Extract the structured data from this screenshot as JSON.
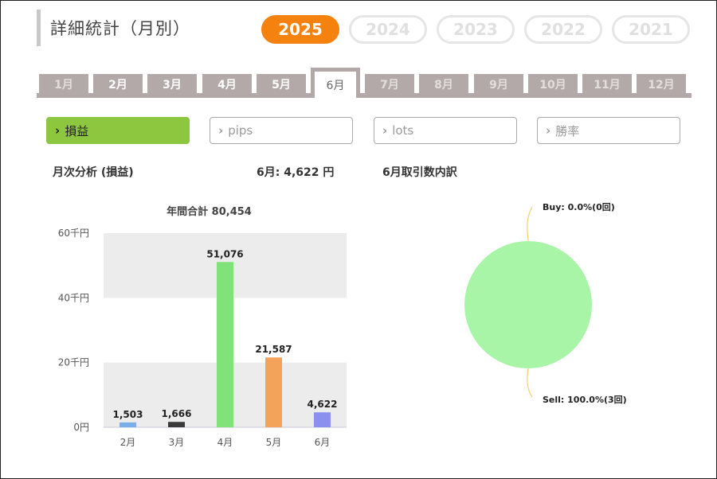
{
  "header": {
    "title": "詳細統計（月別）"
  },
  "years": [
    {
      "label": "2025",
      "active": true
    },
    {
      "label": "2024",
      "active": false
    },
    {
      "label": "2023",
      "active": false
    },
    {
      "label": "2022",
      "active": false
    },
    {
      "label": "2021",
      "active": false
    }
  ],
  "months": [
    {
      "label": "1月",
      "state": "dim"
    },
    {
      "label": "2月",
      "state": "normal"
    },
    {
      "label": "3月",
      "state": "normal"
    },
    {
      "label": "4月",
      "state": "normal"
    },
    {
      "label": "5月",
      "state": "normal"
    },
    {
      "label": "6月",
      "state": "active"
    },
    {
      "label": "7月",
      "state": "dim"
    },
    {
      "label": "8月",
      "state": "dim"
    },
    {
      "label": "9月",
      "state": "dim"
    },
    {
      "label": "10月",
      "state": "dim"
    },
    {
      "label": "11月",
      "state": "dim"
    },
    {
      "label": "12月",
      "state": "dim"
    }
  ],
  "metrics": [
    {
      "label": "損益",
      "active": true
    },
    {
      "label": "pips",
      "active": false
    },
    {
      "label": "lots",
      "active": false
    },
    {
      "label": "勝率",
      "active": false
    }
  ],
  "summary": {
    "analysis_label": "月次分析 (損益)",
    "month_total": "6月:  4,622 円",
    "breakdown_label": "6月取引数内訳"
  },
  "colors": {
    "accent_orange": "#f5820f",
    "accent_green": "#8dc63f",
    "tab_gray": "#b3a9a9"
  },
  "chart_data": [
    {
      "type": "bar",
      "title": "年間合計 80,454",
      "categories": [
        "2月",
        "3月",
        "4月",
        "5月",
        "6月"
      ],
      "values": [
        1503,
        1666,
        51076,
        21587,
        4622
      ],
      "value_labels": [
        "1,503",
        "1,666",
        "51,076",
        "21,587",
        "4,622"
      ],
      "colors": [
        "#7aaee8",
        "#3a3a3a",
        "#7fe37a",
        "#f5a25a",
        "#8a8ff0"
      ],
      "ylim": [
        0,
        60000
      ],
      "yticks": [
        {
          "value": 0,
          "label": "0円"
        },
        {
          "value": 20000,
          "label": "20千円"
        },
        {
          "value": 40000,
          "label": "40千円"
        },
        {
          "value": 60000,
          "label": "60千円"
        }
      ],
      "grid": "alternating bands"
    },
    {
      "type": "pie",
      "slices": [
        {
          "label": "Buy: 0.0%(0回)",
          "value": 0,
          "color": "#f0d070"
        },
        {
          "label": "Sell: 100.0%(3回)",
          "value": 100,
          "color": "#a8f5a8"
        }
      ]
    }
  ]
}
